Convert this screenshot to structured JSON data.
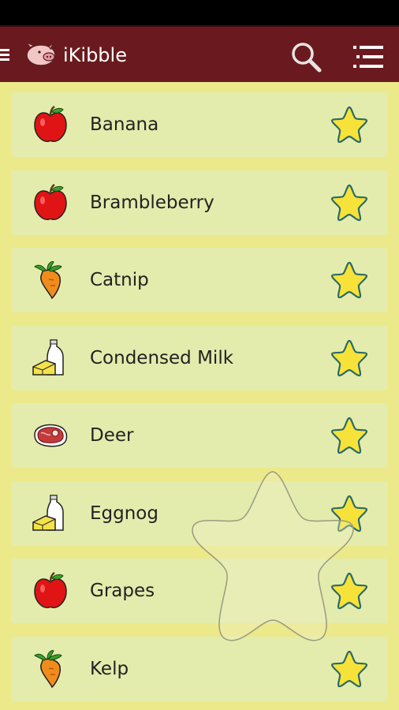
{
  "app": {
    "title": "iKibble"
  },
  "toolbar": {
    "search_icon": "search-icon",
    "list_icon": "list-view-icon",
    "drawer_icon": "drawer-menu-icon"
  },
  "items": [
    {
      "name": "Banana",
      "icon": "apple-icon",
      "category": "fruit"
    },
    {
      "name": "Brambleberry",
      "icon": "apple-icon",
      "category": "fruit"
    },
    {
      "name": "Catnip",
      "icon": "carrot-icon",
      "category": "vegetable"
    },
    {
      "name": "Condensed Milk",
      "icon": "dairy-icon",
      "category": "dairy"
    },
    {
      "name": "Deer",
      "icon": "meat-icon",
      "category": "meat"
    },
    {
      "name": "Eggnog",
      "icon": "dairy-icon",
      "category": "dairy"
    },
    {
      "name": "Grapes",
      "icon": "apple-icon",
      "category": "fruit"
    },
    {
      "name": "Kelp",
      "icon": "carrot-icon",
      "category": "vegetable"
    }
  ],
  "colors": {
    "appbar": "#6a1a1e",
    "background": "#ece98a",
    "card": "#e3ecac",
    "star": "#f7e23a"
  }
}
